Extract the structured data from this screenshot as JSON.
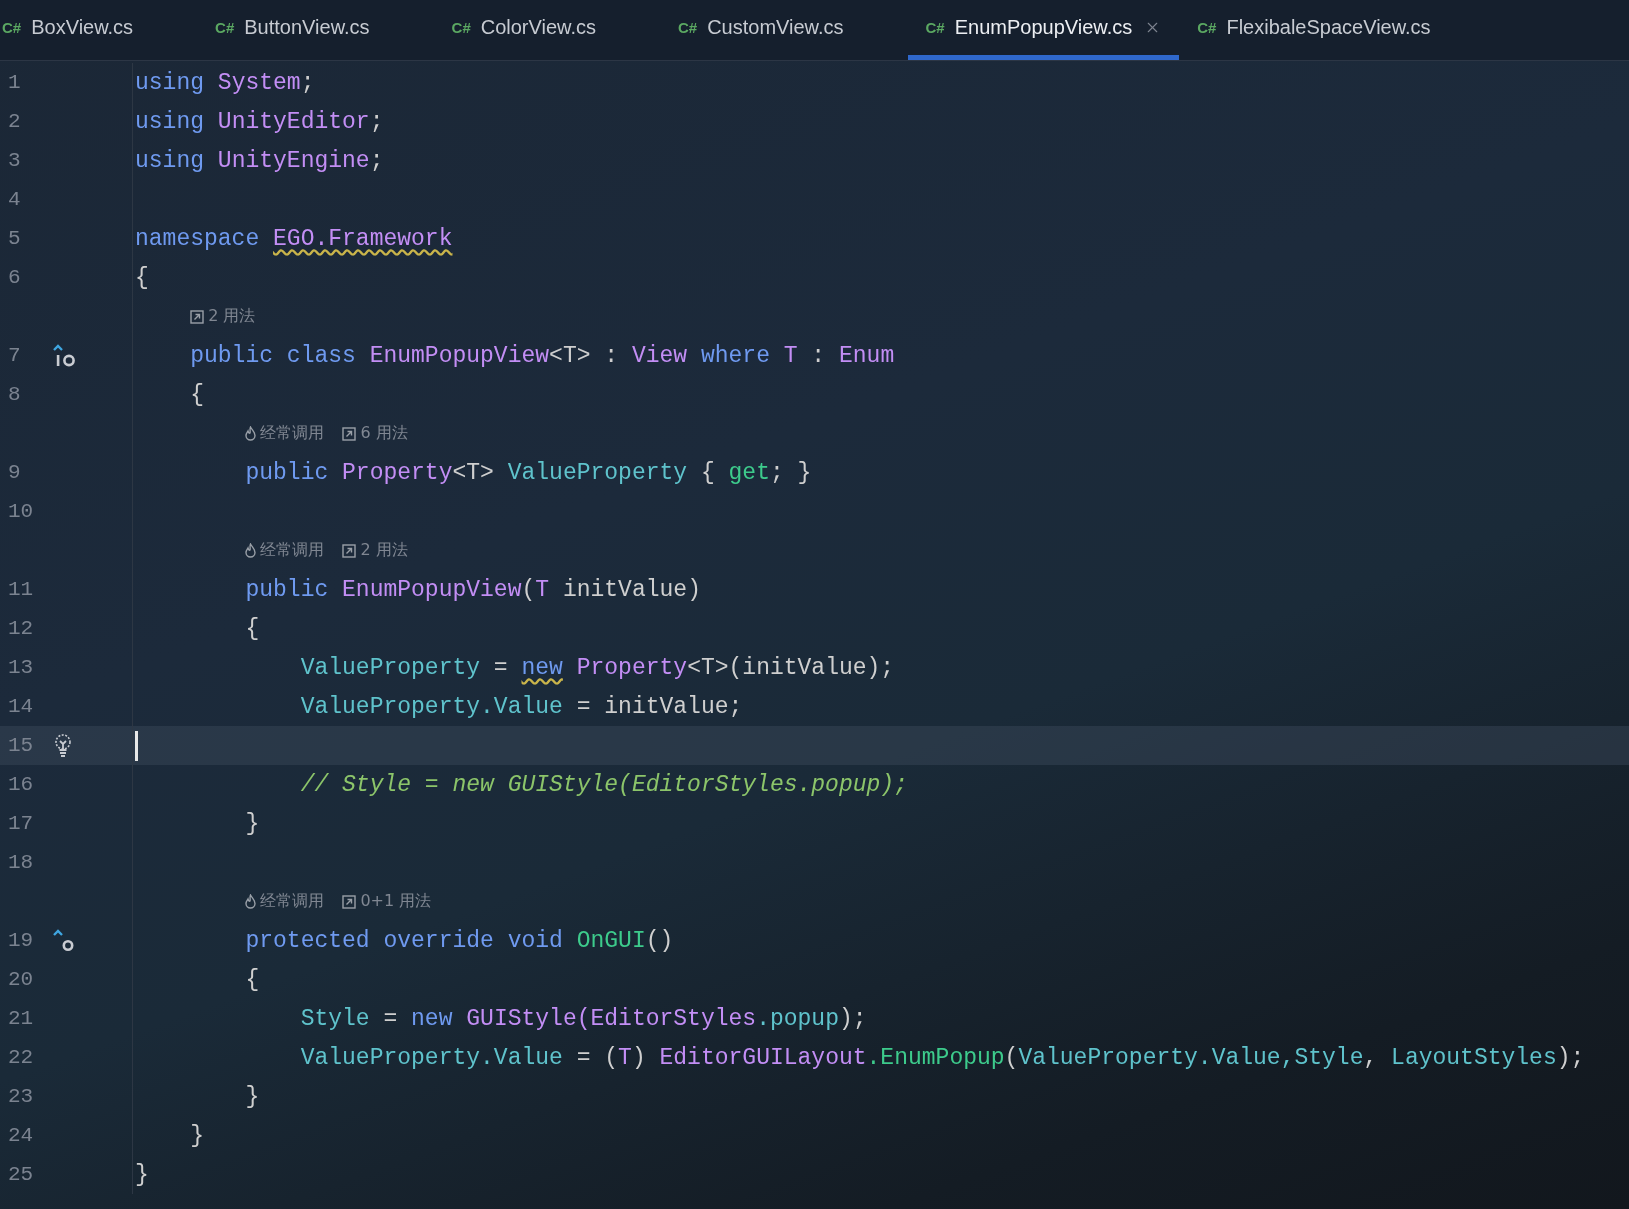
{
  "tabs": [
    {
      "label": "BoxView.cs",
      "badge": "C#",
      "selected": false
    },
    {
      "label": "ButtonView.cs",
      "badge": "C#",
      "selected": false
    },
    {
      "label": "ColorView.cs",
      "badge": "C#",
      "selected": false
    },
    {
      "label": "CustomView.cs",
      "badge": "C#",
      "selected": false
    },
    {
      "label": "EnumPopupView.cs",
      "badge": "C#",
      "selected": true
    },
    {
      "label": "FlexibaleSpaceView.cs",
      "badge": "C#",
      "selected": false
    }
  ],
  "editor": {
    "rows": [
      {
        "number": "1",
        "tokens": [
          {
            "t": "using ",
            "kind": "kw"
          },
          {
            "t": "System",
            "kind": "type"
          },
          {
            "t": ";",
            "kind": "plain"
          }
        ]
      },
      {
        "number": "2",
        "tokens": [
          {
            "t": "using ",
            "kind": "kw"
          },
          {
            "t": "UnityEditor",
            "kind": "type"
          },
          {
            "t": ";",
            "kind": "plain"
          }
        ]
      },
      {
        "number": "3",
        "tokens": [
          {
            "t": "using ",
            "kind": "kw"
          },
          {
            "t": "UnityEngine",
            "kind": "type"
          },
          {
            "t": ";",
            "kind": "plain"
          }
        ]
      },
      {
        "number": "4"
      },
      {
        "number": "5",
        "tokens": [
          {
            "t": "namespace ",
            "kind": "kw"
          },
          {
            "t": "EGO.Framework",
            "kind": "type",
            "warning": true
          }
        ]
      },
      {
        "number": "6",
        "tokens": [
          {
            "t": "{",
            "kind": "plain"
          }
        ]
      },
      {
        "number": "7",
        "hints": [
          {
            "kind": "usages",
            "text": "2 用法"
          }
        ],
        "marker": {
          "kind": "implemented"
        },
        "tokens": [
          {
            "t": "    public class ",
            "kind": "kw"
          },
          {
            "t": "EnumPopupView",
            "kind": "type"
          },
          {
            "t": "<T> : ",
            "kind": "plain"
          },
          {
            "t": "View ",
            "kind": "type"
          },
          {
            "t": "where ",
            "kind": "kw"
          },
          {
            "t": "T",
            "kind": "type"
          },
          {
            "t": " : ",
            "kind": "plain"
          },
          {
            "t": "Enum",
            "kind": "type"
          }
        ]
      },
      {
        "number": "8",
        "tokens": [
          {
            "t": "    {",
            "kind": "plain"
          }
        ]
      },
      {
        "number": "9",
        "hints": [
          {
            "kind": "hot",
            "text": "经常调用"
          },
          {
            "kind": "usages",
            "text": "6 用法"
          }
        ],
        "tokens": [
          {
            "t": "        public ",
            "kind": "kw"
          },
          {
            "t": "Property",
            "kind": "type"
          },
          {
            "t": "<T> ",
            "kind": "plain"
          },
          {
            "t": "ValueProperty",
            "kind": "ident"
          },
          {
            "t": " { ",
            "kind": "plain"
          },
          {
            "t": "get",
            "kind": "method"
          },
          {
            "t": "; }",
            "kind": "plain"
          }
        ]
      },
      {
        "number": "10"
      },
      {
        "number": "11",
        "hints": [
          {
            "kind": "hot",
            "text": "经常调用"
          },
          {
            "kind": "usages",
            "text": "2 用法"
          }
        ],
        "tokens": [
          {
            "t": "        public ",
            "kind": "kw"
          },
          {
            "t": "EnumPopupView",
            "kind": "type"
          },
          {
            "t": "(",
            "kind": "plain"
          },
          {
            "t": "T",
            "kind": "type"
          },
          {
            "t": " initValue)",
            "kind": "plain"
          }
        ]
      },
      {
        "number": "12",
        "tokens": [
          {
            "t": "        {",
            "kind": "plain"
          }
        ]
      },
      {
        "number": "13",
        "tokens": [
          {
            "t": "            ValueProperty",
            "kind": "ident"
          },
          {
            "t": " = ",
            "kind": "plain"
          },
          {
            "t": "new",
            "kind": "kw",
            "warning": true
          },
          {
            "t": " Property",
            "kind": "type"
          },
          {
            "t": "<T>(initValue);",
            "kind": "plain"
          }
        ]
      },
      {
        "number": "14",
        "tokens": [
          {
            "t": "            ValueProperty.Value",
            "kind": "ident"
          },
          {
            "t": " = initValue;",
            "kind": "plain"
          }
        ]
      },
      {
        "number": "15",
        "marker": {
          "kind": "bulb"
        },
        "current": true
      },
      {
        "number": "16",
        "tokens": [
          {
            "t": "            // Style = new GUIStyle(EditorStyles.popup);",
            "kind": "comment"
          }
        ]
      },
      {
        "number": "17",
        "tokens": [
          {
            "t": "        }",
            "kind": "plain"
          }
        ]
      },
      {
        "number": "18"
      },
      {
        "number": "19",
        "hints": [
          {
            "kind": "hot",
            "text": "经常调用"
          },
          {
            "kind": "usages",
            "text": "0+1 用法"
          }
        ],
        "marker": {
          "kind": "override"
        },
        "tokens": [
          {
            "t": "        protected override void ",
            "kind": "kw"
          },
          {
            "t": "OnGUI",
            "kind": "method"
          },
          {
            "t": "()",
            "kind": "plain"
          }
        ]
      },
      {
        "number": "20",
        "tokens": [
          {
            "t": "        {",
            "kind": "plain"
          }
        ]
      },
      {
        "number": "21",
        "tokens": [
          {
            "t": "            Style",
            "kind": "ident"
          },
          {
            "t": " = ",
            "kind": "plain"
          },
          {
            "t": "new ",
            "kind": "kw"
          },
          {
            "t": "GUIStyle(EditorStyles",
            "kind": "type"
          },
          {
            "t": ".popup",
            "kind": "ident"
          },
          {
            "t": ");",
            "kind": "plain"
          }
        ]
      },
      {
        "number": "22",
        "tokens": [
          {
            "t": "            ValueProperty.Value",
            "kind": "ident"
          },
          {
            "t": " = (",
            "kind": "plain"
          },
          {
            "t": "T",
            "kind": "type"
          },
          {
            "t": ") ",
            "kind": "plain"
          },
          {
            "t": "EditorGUILayout",
            "kind": "type"
          },
          {
            "t": ".EnumPopup",
            "kind": "method"
          },
          {
            "t": "(",
            "kind": "plain"
          },
          {
            "t": "ValueProperty.Value,Style",
            "kind": "ident"
          },
          {
            "t": ", ",
            "kind": "plain"
          },
          {
            "t": "LayoutStyles",
            "kind": "ident"
          },
          {
            "t": ");",
            "kind": "plain"
          }
        ]
      },
      {
        "number": "23",
        "tokens": [
          {
            "t": "        }",
            "kind": "plain"
          }
        ]
      },
      {
        "number": "24",
        "tokens": [
          {
            "t": "    }",
            "kind": "plain"
          }
        ]
      },
      {
        "number": "25",
        "tokens": [
          {
            "t": "}",
            "kind": "plain"
          }
        ]
      }
    ]
  }
}
